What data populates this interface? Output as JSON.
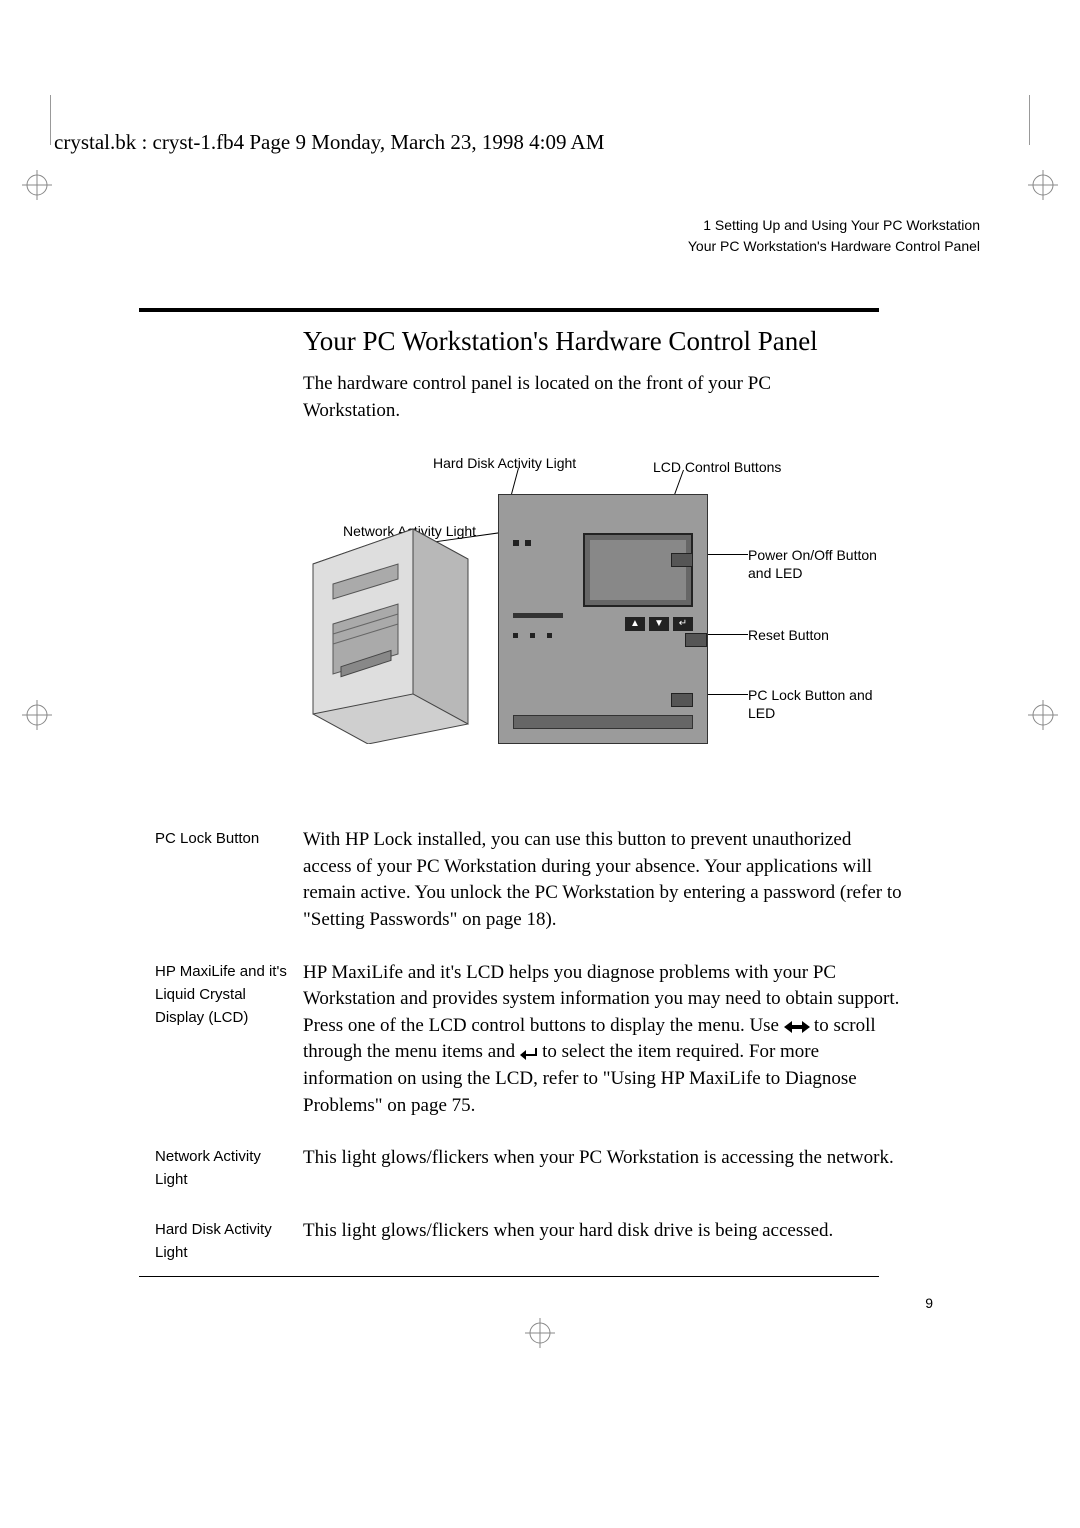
{
  "header_line": "crystal.bk : cryst-1.fb4  Page 9  Monday, March 23, 1998  4:09 AM",
  "page_header": {
    "chapter": "1   Setting Up and Using Your PC Workstation",
    "section": "Your PC Workstation's Hardware Control Panel"
  },
  "title": "Your PC Workstation's Hardware Control Panel",
  "intro": "The hardware control panel is located on the front of your PC Workstation.",
  "figure": {
    "callouts": {
      "hdd": "Hard Disk Activity Light",
      "lcd_buttons": "LCD Control Buttons",
      "network": "Network Activity Light",
      "power": "Power On/Off Button and LED",
      "reset": "Reset Button",
      "pclock": "PC Lock Button and LED"
    }
  },
  "definitions": [
    {
      "term": "PC Lock Button",
      "body": "With HP Lock installed, you can use this button to prevent unauthorized access of your PC Workstation during your absence. Your applications will remain active. You unlock the PC Workstation by entering a password (refer to \"Setting Passwords\" on page 18)."
    },
    {
      "term": "HP MaxiLife and it's Liquid Crystal Display (LCD)",
      "body_pre": "HP MaxiLife and it's LCD helps you diagnose problems with your PC Workstation and provides system information you may need to obtain support. Press one of the LCD control buttons to display the menu. Use ",
      "body_mid": " to scroll through the menu items and ",
      "body_post": " to select the item required. For more information on using the LCD,  refer to \"Using HP MaxiLife to Diagnose Problems\" on page 75."
    },
    {
      "term": "Network Activity Light",
      "body": "This light glows/flickers when your PC Workstation is accessing the network."
    },
    {
      "term": "Hard Disk Activity Light",
      "body": "This light glows/flickers when your hard disk drive is being accessed."
    }
  ],
  "page_number": "9"
}
